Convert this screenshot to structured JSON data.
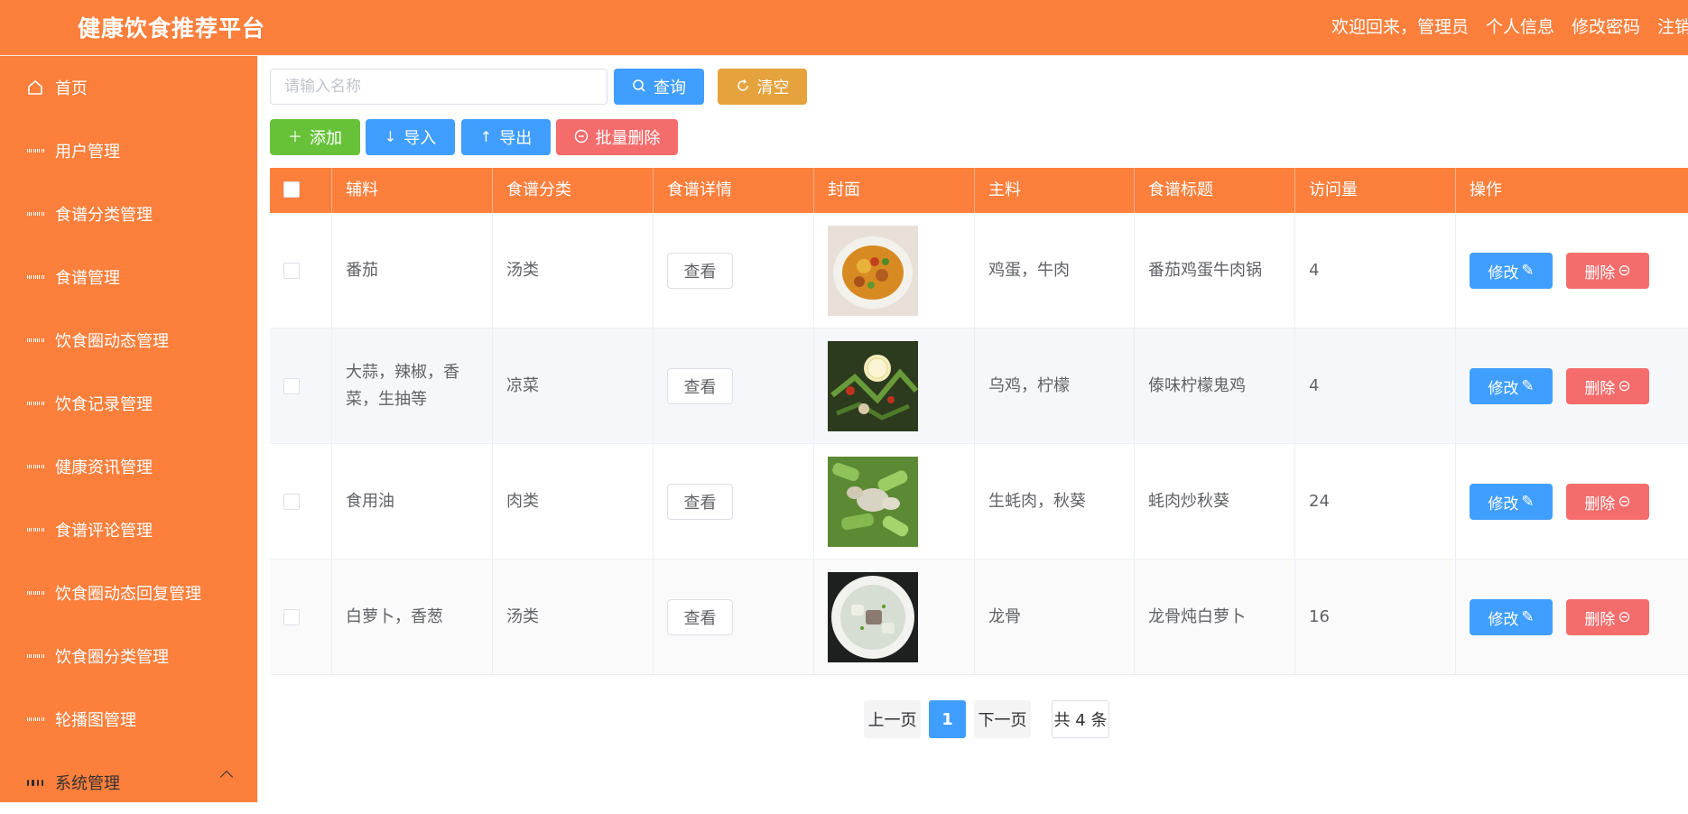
{
  "app": {
    "title": "健康饮食推荐平台"
  },
  "user_nav": {
    "welcome": "欢迎回来，管理员",
    "profile": "个人信息",
    "change_password": "修改密码",
    "logout": "注销"
  },
  "sidebar": {
    "items": [
      {
        "label": "首页",
        "icon": "home-icon"
      },
      {
        "label": "用户管理",
        "icon": "grid-icon"
      },
      {
        "label": "食谱分类管理",
        "icon": "grid-icon"
      },
      {
        "label": "食谱管理",
        "icon": "grid-icon"
      },
      {
        "label": "饮食圈动态管理",
        "icon": "grid-icon"
      },
      {
        "label": "饮食记录管理",
        "icon": "grid-icon"
      },
      {
        "label": "健康资讯管理",
        "icon": "grid-icon"
      },
      {
        "label": "食谱评论管理",
        "icon": "grid-icon"
      },
      {
        "label": "饮食圈动态回复管理",
        "icon": "grid-icon"
      },
      {
        "label": "饮食圈分类管理",
        "icon": "grid-icon"
      },
      {
        "label": "轮播图管理",
        "icon": "grid-icon"
      },
      {
        "label": "系统管理",
        "icon": "menu-grid-icon",
        "expanded": true
      }
    ]
  },
  "toolbar": {
    "search_placeholder": "请输入名称",
    "search_value": "",
    "query_label": "查询",
    "clear_label": "清空",
    "add_label": "添加",
    "import_label": "导入",
    "export_label": "导出",
    "batch_delete_label": "批量删除"
  },
  "table": {
    "columns": [
      "辅料",
      "食谱分类",
      "食谱详情",
      "封面",
      "主料",
      "食谱标题",
      "访问量",
      "操作"
    ],
    "rows": [
      {
        "accessory": "番茄",
        "category": "汤类",
        "detail_btn": "查看",
        "cover": "tomato-egg-beef-soup-photo",
        "main": "鸡蛋，牛肉",
        "title": "番茄鸡蛋牛肉锅",
        "visits": "4"
      },
      {
        "accessory": "大蒜，辣椒，香菜，生抽等",
        "category": "凉菜",
        "detail_btn": "查看",
        "cover": "lemon-chicken-photo",
        "main": "乌鸡，柠檬",
        "title": "傣味柠檬鬼鸡",
        "visits": "4"
      },
      {
        "accessory": "食用油",
        "category": "肉类",
        "detail_btn": "查看",
        "cover": "okra-oyster-photo",
        "main": "生蚝肉，秋葵",
        "title": "蚝肉炒秋葵",
        "visits": "24"
      },
      {
        "accessory": "白萝卜，香葱",
        "category": "汤类",
        "detail_btn": "查看",
        "cover": "radish-pork-bone-soup-photo",
        "main": "龙骨",
        "title": "龙骨炖白萝卜",
        "visits": "16"
      }
    ],
    "edit_label": "修改",
    "delete_label": "删除"
  },
  "pagination": {
    "prev": "上一页",
    "current": "1",
    "next": "下一页",
    "total": "共 4 条"
  },
  "colors": {
    "primary": "#fd7f3c",
    "blue": "#409eff",
    "orange": "#e6a23c",
    "green": "#67c23a",
    "red": "#f56c6c"
  }
}
